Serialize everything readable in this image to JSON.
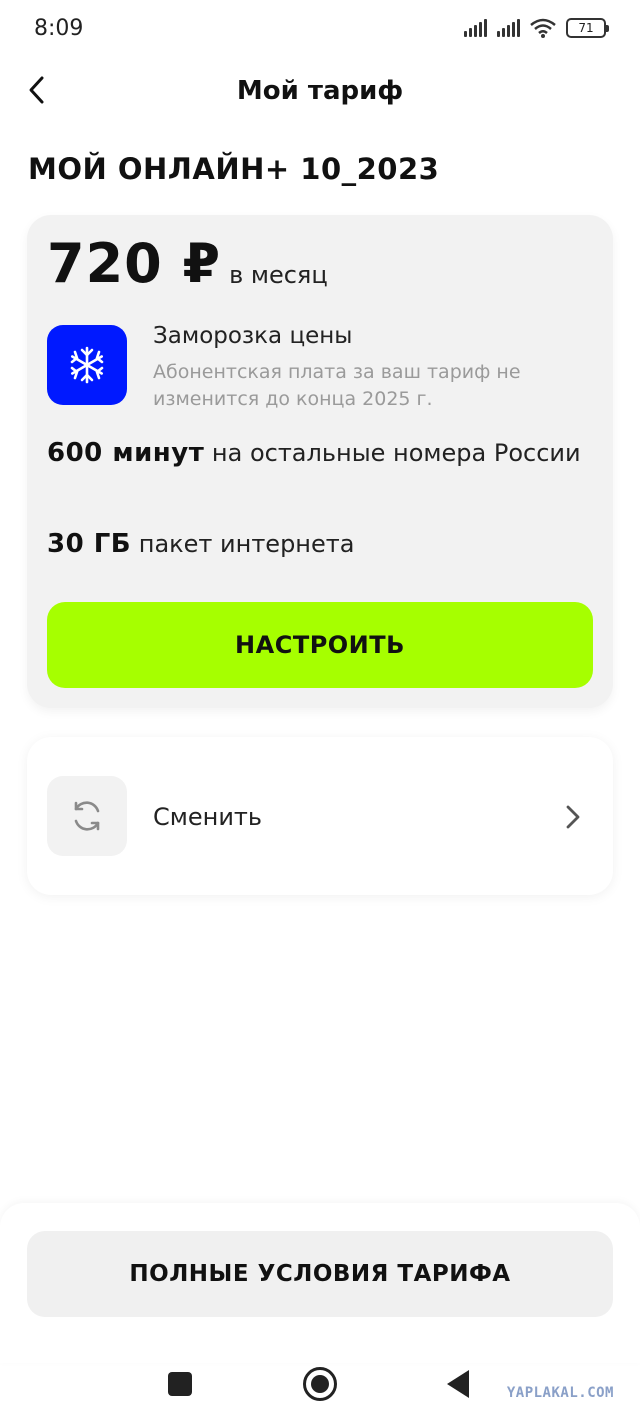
{
  "status_bar": {
    "time": "8:09",
    "battery": "71"
  },
  "header": {
    "title": "Мой тариф",
    "back_icon": "chevron-left-icon"
  },
  "tariff": {
    "name": "МОЙ ОНЛАЙН+ 10_2023",
    "price": "720 ₽",
    "price_period": "в месяц",
    "freeze": {
      "icon": "snowflake-icon",
      "title": "Заморозка цены",
      "description": "Абонентская плата за ваш тариф не изменится до конца 2025 г."
    },
    "minutes": {
      "value": "600 минут",
      "text": "на остальные номера России"
    },
    "internet": {
      "value": "30 ГБ",
      "text": "пакет интернета"
    },
    "configure_label": "НАСТРОИТЬ"
  },
  "change": {
    "icon": "refresh-icon",
    "label": "Сменить"
  },
  "bottom": {
    "full_terms_label": "ПОЛНЫЕ УСЛОВИЯ ТАРИФА"
  },
  "watermark": "YAPLAKAL.COM",
  "colors": {
    "accent_green": "#a6ff00",
    "freeze_blue": "#0019ff",
    "card_bg": "#f2f2f2"
  }
}
